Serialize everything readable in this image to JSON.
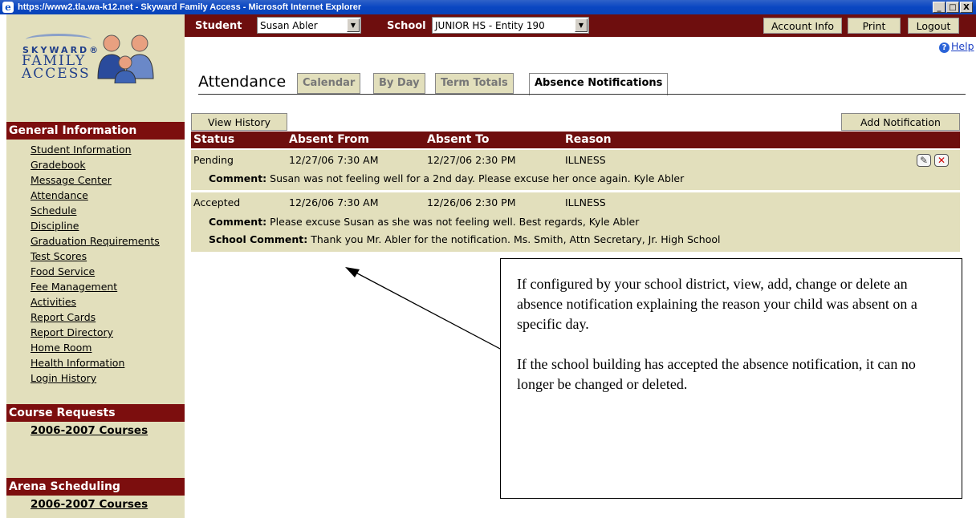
{
  "window": {
    "title": "https://www2.tla.wa-k12.net - Skyward Family Access - Microsoft Internet Explorer",
    "controls": [
      "_",
      "□",
      "X"
    ]
  },
  "logo": {
    "line1": "SKYWARD®",
    "line2": "FAMILY",
    "line3": "ACCESS"
  },
  "topbar": {
    "student_label": "Student",
    "student_value": "Susan Abler",
    "school_label": "School",
    "school_value": "JUNIOR HS - Entity 190",
    "account_info": "Account Info",
    "print": "Print",
    "logout": "Logout"
  },
  "help": "Help",
  "page": {
    "title": "Attendance",
    "tabs": [
      "Calendar",
      "By Day",
      "Term Totals",
      "Absence Notifications"
    ],
    "active_tab": "Absence Notifications",
    "view_history": "View History",
    "add_notification": "Add Notification"
  },
  "sidebar": {
    "general_title": "General Information",
    "general_items": [
      "Student Information",
      "Gradebook",
      "Message Center",
      "Attendance",
      "Schedule",
      "Discipline",
      "Graduation Requirements",
      "Test Scores",
      "Food Service",
      "Fee Management",
      "Activities",
      "Report Cards",
      "Report Directory",
      "Home Room",
      "Health Information",
      "Login History"
    ],
    "course_requests_title": "Course Requests",
    "course_requests_item": "2006-2007 Courses",
    "arena_title": "Arena Scheduling",
    "arena_item": "2006-2007 Courses"
  },
  "table": {
    "headers": {
      "status": "Status",
      "from": "Absent From",
      "to": "Absent To",
      "reason": "Reason"
    },
    "rows": [
      {
        "status": "Pending",
        "from": "12/27/06  7:30 AM",
        "to": "12/27/06  2:30 PM",
        "reason": "ILLNESS",
        "comment_label": "Comment:",
        "comment": " Susan was not feeling well for a 2nd day. Please excuse her once again. Kyle Abler"
      },
      {
        "status": "Accepted",
        "from": "12/26/06  7:30 AM",
        "to": "12/26/06  2:30 PM",
        "reason": "ILLNESS",
        "comment_label": "Comment:",
        "comment": " Please excuse Susan as she was not feeling well. Best regards, Kyle Abler",
        "school_comment_label": "School Comment:",
        "school_comment": " Thank you Mr. Abler for the notification. Ms. Smith, Attn Secretary, Jr. High School"
      }
    ]
  },
  "callout": {
    "p1": "If configured by your school district, view, add, change or delete an absence notification explaining the reason your child was absent on a specific day.",
    "p2": "If the school building has accepted the absence notification, it can no longer be changed or deleted."
  },
  "colors": {
    "maroon": "#6e0e0e",
    "tan": "#e2dfbc",
    "titlebar": "#0a46c2"
  }
}
